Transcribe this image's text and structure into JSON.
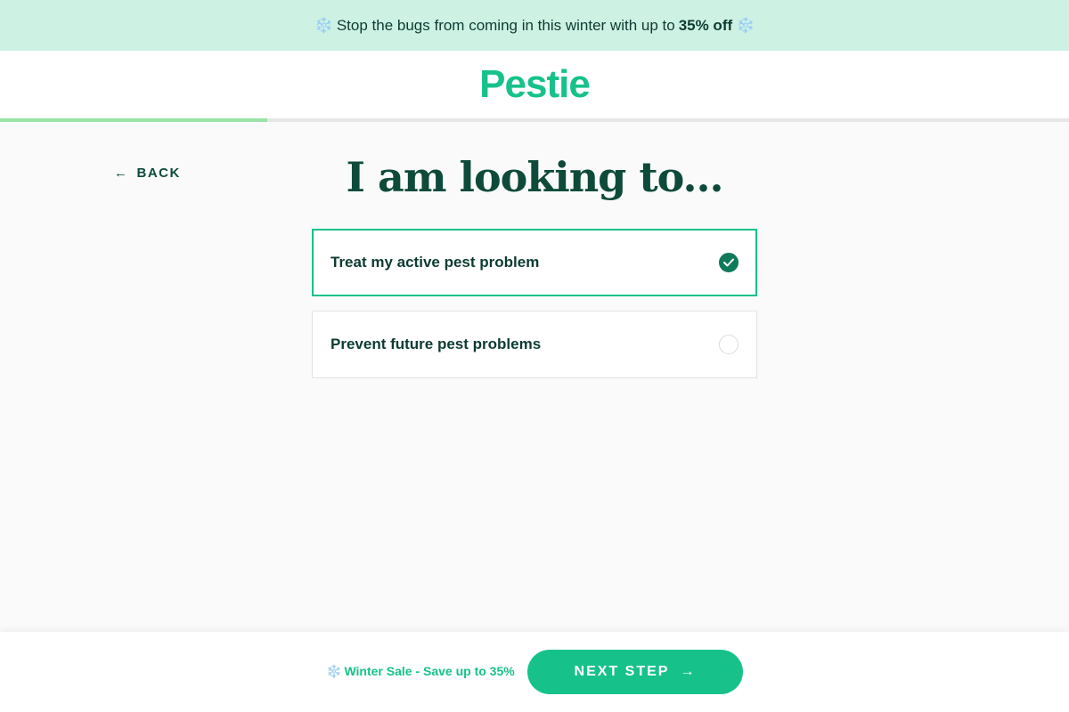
{
  "promo": {
    "text": "Stop the bugs from coming in this winter with up to",
    "highlight": "35% off",
    "snow_icon": "❄️"
  },
  "header": {
    "logo": "Pestie"
  },
  "progress": {
    "fraction": 0.25
  },
  "nav": {
    "back_label": "BACK"
  },
  "main": {
    "title": "I am looking to...",
    "options": [
      {
        "label": "Treat my active pest problem",
        "selected": true
      },
      {
        "label": "Prevent future pest problems",
        "selected": false
      }
    ]
  },
  "footer": {
    "sale_text": "Winter Sale - Save up to 35%",
    "next_label": "NEXT STEP"
  },
  "colors": {
    "brand_green": "#16c28a",
    "dark_green": "#0d4a3a",
    "promo_bg": "#cdf2e3",
    "progress": "#9be3a7"
  }
}
